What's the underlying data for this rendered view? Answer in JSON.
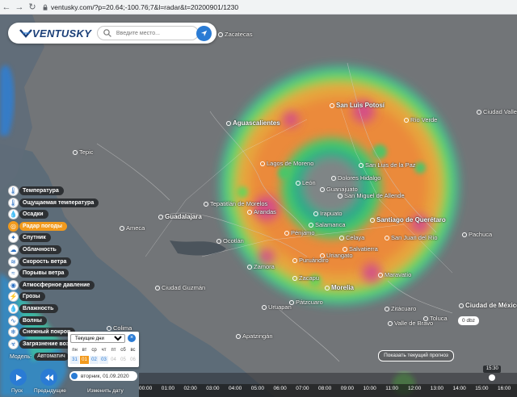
{
  "browser": {
    "url": "ventusky.com/?p=20.64;-100.76;7&l=radar&t=20200901/1230"
  },
  "header": {
    "logo_text": "VENTUSKY",
    "search_placeholder": "Введите место..."
  },
  "layers": [
    {
      "label": "Температура",
      "icon": "thermometer-icon",
      "active": false
    },
    {
      "label": "Ощущаемая температура",
      "icon": "thermometer-feels-icon",
      "active": false
    },
    {
      "label": "Осадки",
      "icon": "raindrop-icon",
      "active": false
    },
    {
      "label": "Радар погоды",
      "icon": "radar-icon",
      "active": true
    },
    {
      "label": "Спутник",
      "icon": "satellite-icon",
      "active": false
    },
    {
      "label": "Облачность",
      "icon": "cloud-icon",
      "active": false
    },
    {
      "label": "Скорость ветра",
      "icon": "wind-icon",
      "active": false
    },
    {
      "label": "Порывы ветра",
      "icon": "wind-gust-icon",
      "active": false
    },
    {
      "label": "Атмосферное давление",
      "icon": "pressure-icon",
      "active": false
    },
    {
      "label": "Грозы",
      "icon": "lightning-icon",
      "active": false
    },
    {
      "label": "Влажность",
      "icon": "humidity-icon",
      "active": false
    },
    {
      "label": "Волны",
      "icon": "wave-icon",
      "active": false
    },
    {
      "label": "Снежный покров",
      "icon": "snowflake-icon",
      "active": false
    },
    {
      "label": "Загрязнение воз",
      "icon": "pollution-icon",
      "active": false
    }
  ],
  "model": {
    "label": "Модель:",
    "value": "Автоматич"
  },
  "calendar": {
    "mode": "Текущие дни",
    "weekdays": [
      "пн",
      "вт",
      "ср",
      "чт",
      "пт",
      "сб",
      "вс"
    ],
    "days": [
      "31",
      "01",
      "02",
      "03",
      "04",
      "05",
      "06"
    ],
    "selected_index": 1
  },
  "controls": {
    "play_label": "Пуск",
    "prev_label": "Предыдущие",
    "date_text": "вторник, 01.09.2020",
    "change_date_label": "Изменить дату"
  },
  "timeline": {
    "current_time": "15:30",
    "current_fraction": 0.976,
    "hours": [
      "00:00",
      "01:00",
      "02:00",
      "03:00",
      "04:00",
      "05:00",
      "06:00",
      "07:00",
      "08:00",
      "09:00",
      "10:00",
      "11:00",
      "12:00",
      "13:00",
      "14:00",
      "15:00",
      "16:00"
    ]
  },
  "show_forecast_label": "Показать текущий прогноз",
  "legend_value": "0 dbz",
  "cities": [
    {
      "name": "San Luis Potosí",
      "big": true
    },
    {
      "name": "Aguascalientes",
      "big": true
    },
    {
      "name": "Río Verde",
      "big": false
    },
    {
      "name": "Tepic",
      "big": false
    },
    {
      "name": "Lagos de Moreno",
      "big": false
    },
    {
      "name": "San Luis de la Paz",
      "big": false
    },
    {
      "name": "León",
      "big": false
    },
    {
      "name": "Dolores Hidalgo",
      "big": false
    },
    {
      "name": "Guanajuato",
      "big": false
    },
    {
      "name": "San Miguel de Allende",
      "big": false
    },
    {
      "name": "Tepatitlán de Morelos",
      "big": false
    },
    {
      "name": "Arandas",
      "big": false
    },
    {
      "name": "Irapuato",
      "big": false
    },
    {
      "name": "Guadalajara",
      "big": true
    },
    {
      "name": "Salamanca",
      "big": false
    },
    {
      "name": "Santiago de Querétaro",
      "big": true
    },
    {
      "name": "Pénjamo",
      "big": false
    },
    {
      "name": "San Juan del Río",
      "big": false
    },
    {
      "name": "Celaya",
      "big": false
    },
    {
      "name": "Ocotlán",
      "big": false
    },
    {
      "name": "Uriangato",
      "big": false
    },
    {
      "name": "Salvatierra",
      "big": false
    },
    {
      "name": "Puruándiro",
      "big": false
    },
    {
      "name": "Zamora",
      "big": false
    },
    {
      "name": "Maravatío",
      "big": false
    },
    {
      "name": "Zacapu",
      "big": false
    },
    {
      "name": "Morelia",
      "big": true
    },
    {
      "name": "Ciudad Guzmán",
      "big": false
    },
    {
      "name": "Uruapan",
      "big": false
    },
    {
      "name": "Pátzcuaro",
      "big": false
    },
    {
      "name": "Zitácuaro",
      "big": false
    },
    {
      "name": "Ciudad de México",
      "big": true
    },
    {
      "name": "Toluca",
      "big": false
    },
    {
      "name": "Colima",
      "big": false
    },
    {
      "name": "Apatzingán",
      "big": false
    },
    {
      "name": "Pachuca",
      "big": false
    },
    {
      "name": "Ameca",
      "big": false
    },
    {
      "name": "Valle de Bravo",
      "big": false
    },
    {
      "name": "Ciudad Valles",
      "big": false
    },
    {
      "name": "Zacatecas",
      "big": false
    }
  ]
}
